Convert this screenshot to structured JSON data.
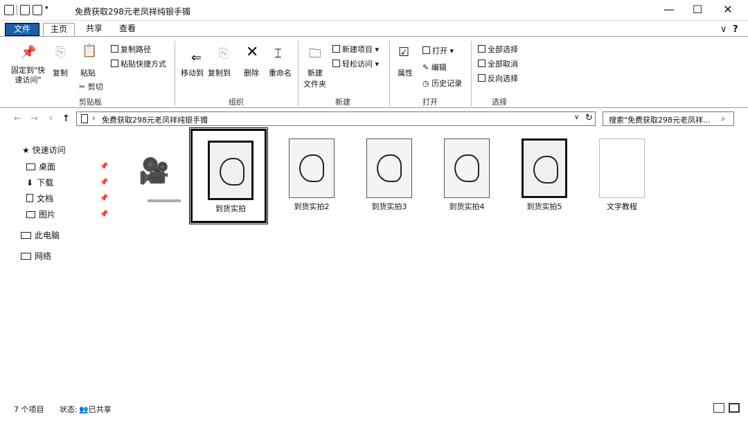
{
  "window": {
    "title": "免费获取298元老凤祥纯银手镯",
    "minimize": "—",
    "maximize": "☐",
    "close": "✕"
  },
  "tabs": {
    "file": "文件",
    "home": "主页",
    "share": "共享",
    "view": "查看",
    "collapse": "∨",
    "help": "?"
  },
  "ribbon": {
    "pin_quick_access": "固定到\"快\n速访问\"",
    "copy": "复制",
    "paste": "粘贴",
    "copy_path": "复制路径",
    "paste_shortcut": "粘贴快捷方式",
    "cut": "剪切",
    "move_to": "移动到",
    "copy_to": "复制到",
    "delete": "删除",
    "rename": "重命名",
    "new_folder_1": "新建",
    "new_folder_2": "文件夹",
    "new_item": "新建项目 ▾",
    "easy_access": "轻松访问 ▾",
    "properties": "属性",
    "open": "打开 ▾",
    "edit": "编辑",
    "history": "历史记录",
    "select_all": "全部选择",
    "select_none": "全部取消",
    "invert_selection": "反向选择",
    "groups": {
      "clipboard": "剪贴板",
      "organize": "组织",
      "new": "新建",
      "open": "打开",
      "select": "选择"
    }
  },
  "address": {
    "back": "←",
    "forward": "→",
    "recent": "∨",
    "up": "↑",
    "path": "免费获取298元老凤祥纯银手镯",
    "search_placeholder": "搜索\"免费获取298元老凤祥...",
    "refresh": "↻"
  },
  "sidebar": {
    "quick_access": "快速访问",
    "items": [
      {
        "label": "桌面",
        "pinned": true
      },
      {
        "label": "下载",
        "pinned": true
      },
      {
        "label": "文档",
        "pinned": true
      },
      {
        "label": "图片",
        "pinned": true
      }
    ],
    "this_pc": "此电脑",
    "network": "网络"
  },
  "files": [
    {
      "name": "",
      "kind": "video"
    },
    {
      "name": "到货实拍",
      "kind": "image",
      "selected": true
    },
    {
      "name": "到货实拍2",
      "kind": "image"
    },
    {
      "name": "到货实拍3",
      "kind": "image"
    },
    {
      "name": "到货实拍4",
      "kind": "image"
    },
    {
      "name": "到货实拍5",
      "kind": "image"
    },
    {
      "name": "文字教程",
      "kind": "document"
    }
  ],
  "status": {
    "count": "7 个项目",
    "state_label": "状态:",
    "state_value": "已共享"
  }
}
